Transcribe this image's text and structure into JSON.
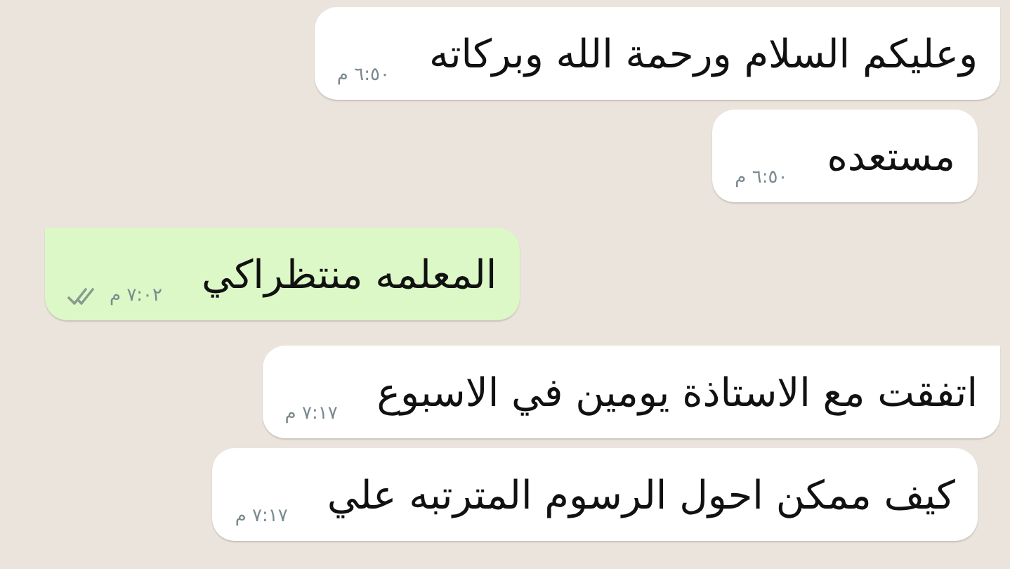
{
  "messages": [
    {
      "kind": "incoming",
      "tail": true,
      "text": "وعليكم السلام ورحمة الله وبركاته",
      "time": "٦:٥٠ م"
    },
    {
      "kind": "incoming",
      "tail": false,
      "text": "مستعده",
      "time": "٦:٥٠ م"
    },
    {
      "kind": "outgoing",
      "tail": true,
      "text": "المعلمه منتظراكي",
      "time": "٧:٠٢ م",
      "read": false
    },
    {
      "kind": "incoming",
      "tail": true,
      "text": "اتفقت مع الاستاذة يومين في الاسبوع",
      "time": "٧:١٧ م"
    },
    {
      "kind": "incoming",
      "tail": false,
      "text": "كيف ممكن احول الرسوم المترتبه علي",
      "time": "٧:١٧ م"
    }
  ]
}
